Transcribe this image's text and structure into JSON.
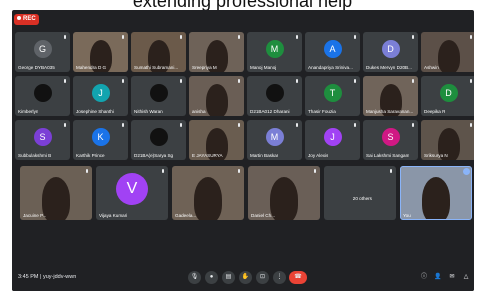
{
  "caption": "extending professional help",
  "rec_label": "REC",
  "meeting_code_time": "3:45 PM | yuy-jddv-wwn",
  "tiles": [
    {
      "name": "George DYBA035",
      "avatar": "G",
      "color": "#5f6368",
      "video": false
    },
    {
      "name": "Mahendra D G",
      "avatar": "",
      "color": "#7a6a5a",
      "video": true
    },
    {
      "name": "Sumathi Subramani...",
      "avatar": "",
      "color": "#6b5a4a",
      "video": true
    },
    {
      "name": "Sreepriya M",
      "avatar": "",
      "color": "#6e6258",
      "video": true
    },
    {
      "name": "Manoj Manoj",
      "avatar": "M",
      "color": "#1e8e3e",
      "video": false
    },
    {
      "name": "Anandapriya Sriniva...",
      "avatar": "A",
      "color": "#1a73e8",
      "video": false
    },
    {
      "name": "Dukes Mervyn D20B...",
      "avatar": "D",
      "color": "#7b7fd6",
      "video": false
    },
    {
      "name": "Ashwin",
      "avatar": "",
      "color": "#5c5048",
      "video": true
    },
    {
      "name": "Kimberlyn",
      "avatar": "",
      "color": "#3c4043",
      "video": false
    },
    {
      "name": "Josephine Shanthi",
      "avatar": "J",
      "color": "#12a4af",
      "video": false
    },
    {
      "name": "Nithish Waran",
      "avatar": "",
      "color": "#3c4043",
      "video": false
    },
    {
      "name": "anisha",
      "avatar": "",
      "color": "#6a5e55",
      "video": true
    },
    {
      "name": "D21BA012 Dharani",
      "avatar": "",
      "color": "#3c4043",
      "video": false
    },
    {
      "name": "Thasir Fouzia",
      "avatar": "T",
      "color": "#1e8e3e",
      "video": false
    },
    {
      "name": "Manjusha Saravanan...",
      "avatar": "",
      "color": "#70645a",
      "video": true
    },
    {
      "name": "Deepika R",
      "avatar": "D",
      "color": "#1e8e3e",
      "video": false
    },
    {
      "name": "Subbulakshmi B",
      "avatar": "S",
      "color": "#7b3fd6",
      "video": false
    },
    {
      "name": "Karthik Prince",
      "avatar": "K",
      "color": "#1a73e8",
      "video": false
    },
    {
      "name": "D21BA(e)Sarya Sg",
      "avatar": "",
      "color": "#3c4043",
      "video": false
    },
    {
      "name": "E JAYASURYA",
      "avatar": "",
      "color": "#6a5d50",
      "video": true
    },
    {
      "name": "Martin Baskar",
      "avatar": "M",
      "color": "#7b7fd6",
      "video": false
    },
    {
      "name": "Joy Alexis",
      "avatar": "J",
      "color": "#a142f4",
      "video": false
    },
    {
      "name": "Sai Lakshmi Sangam",
      "avatar": "S",
      "color": "#d01884",
      "video": false
    },
    {
      "name": "Sriksurya N",
      "avatar": "",
      "color": "#5e544b",
      "video": true
    },
    {
      "name": "Jacuine P...",
      "avatar": "",
      "color": "#6b6055",
      "video": true
    },
    {
      "name": "Vijaya Kumari",
      "avatar": "V",
      "color": "#a142f4",
      "video": false
    },
    {
      "name": "Gadeela...",
      "avatar": "",
      "color": "#6f6256",
      "video": true
    },
    {
      "name": "Daniel Ch...",
      "avatar": "",
      "color": "#6a5f57",
      "video": true
    },
    {
      "name": "20 others",
      "avatar": "",
      "color": "#3c4043",
      "video": false
    },
    {
      "name": "You",
      "avatar": "",
      "color": "#8a96a8",
      "video": true
    }
  ],
  "controls": [
    "mic",
    "camera",
    "captions",
    "raise-hand",
    "present",
    "more",
    "end-call"
  ],
  "right_icons": [
    "info",
    "people",
    "chat",
    "activities"
  ],
  "colors": {
    "background": "#202124",
    "tile": "#3c4043",
    "end_call": "#ea4335",
    "rec": "#d93025"
  }
}
